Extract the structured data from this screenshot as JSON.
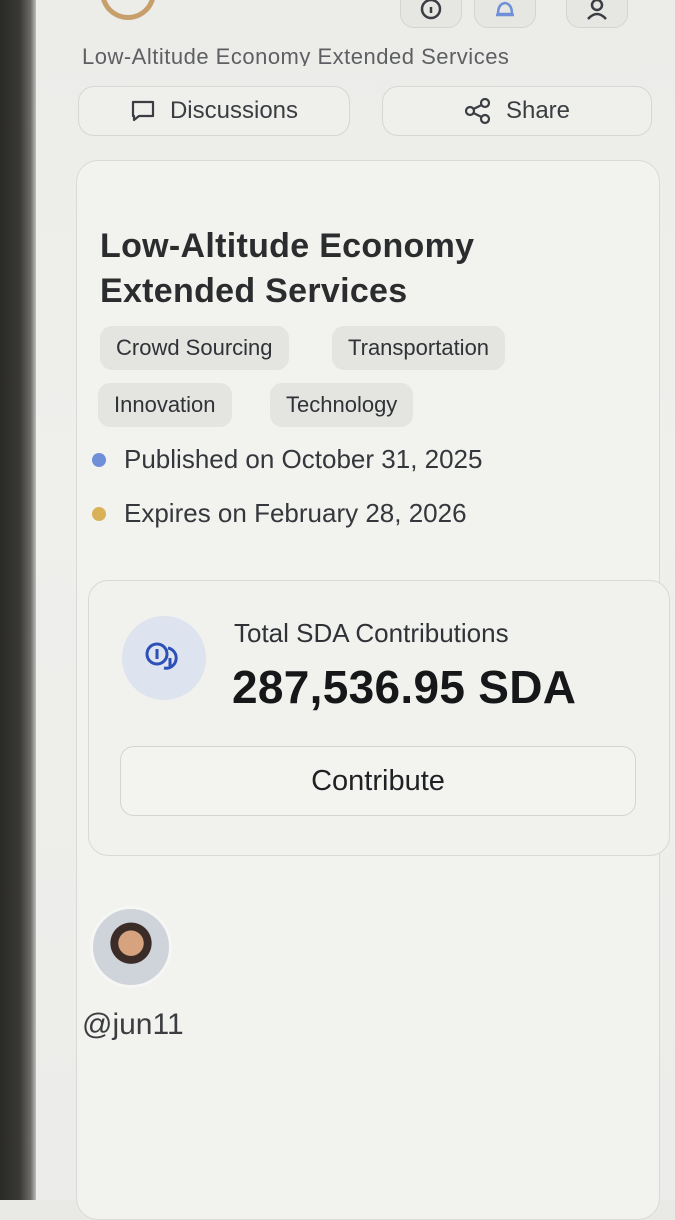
{
  "header": {
    "subtitle": "Low-Altitude Economy Extended Services"
  },
  "actions": {
    "discussions_label": "Discussions",
    "share_label": "Share"
  },
  "project": {
    "title": "Low-Altitude Economy Extended Services",
    "tags": [
      "Crowd Sourcing",
      "Transportation",
      "Innovation",
      "Technology"
    ],
    "published": "Published on October 31, 2025",
    "expires": "Expires on February 28, 2026"
  },
  "contributions": {
    "label": "Total SDA Contributions",
    "value": "287,536.95 SDA",
    "button_label": "Contribute"
  },
  "author": {
    "username": "@jun11"
  },
  "colors": {
    "published_dot": "#6f8fd8",
    "expires_dot": "#d9b257",
    "logo": "#c79f6b"
  },
  "icons": [
    "logo-icon",
    "info-icon",
    "bell-icon",
    "user-icon",
    "chat-icon",
    "share-icon",
    "coins-icon"
  ]
}
